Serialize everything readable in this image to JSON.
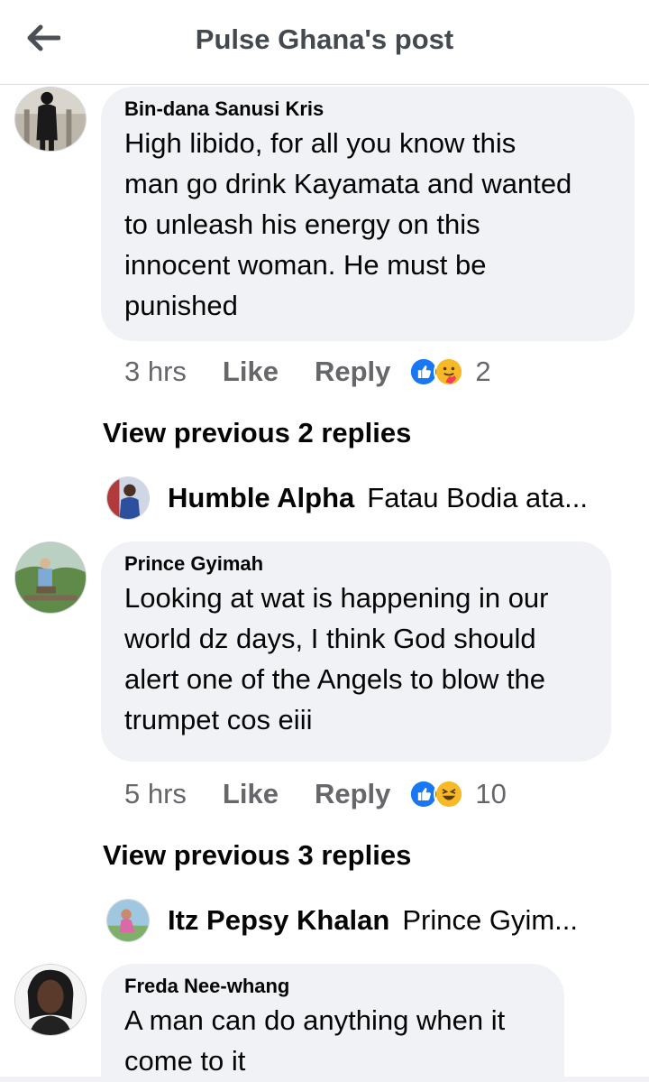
{
  "header": {
    "back_icon": "arrow-left-icon",
    "title": "Pulse Ghana's post"
  },
  "comments": [
    {
      "author": "Bin-dana Sanusi Kris",
      "lines": [
        "High libido, for all you know this",
        "man go drink Kayamata and wanted",
        "to unleash his energy on this",
        "innocent woman. He must be",
        "punished"
      ],
      "time": "3 hrs",
      "like_label": "Like",
      "reply_label": "Reply",
      "reaction_icons": [
        "like-reaction-icon",
        "care-reaction-icon"
      ],
      "reaction_count": "2",
      "view_previous": "View previous 2 replies",
      "latest_reply": {
        "name": "Humble Alpha",
        "preview": "Fatau Bodia ata..."
      }
    },
    {
      "author": "Prince Gyimah",
      "lines": [
        "Looking at wat is happening in our",
        "world dz days, I think God should",
        "alert one of the Angels to blow the",
        "trumpet cos eiii"
      ],
      "time": "5 hrs",
      "like_label": "Like",
      "reply_label": "Reply",
      "reaction_icons": [
        "like-reaction-icon",
        "haha-reaction-icon"
      ],
      "reaction_count": "10",
      "view_previous": "View previous 3 replies",
      "latest_reply": {
        "name": "Itz Pepsy Khalan",
        "preview": "Prince Gyim..."
      }
    },
    {
      "author": "Freda Nee-whang",
      "lines": [
        "A man can do anything when it",
        "come to it"
      ]
    }
  ],
  "colors": {
    "bubble": "#f0f2f5",
    "meta_text": "#65676b",
    "like_blue": "#1877f2",
    "emoji_yellow": "#f7b928"
  }
}
